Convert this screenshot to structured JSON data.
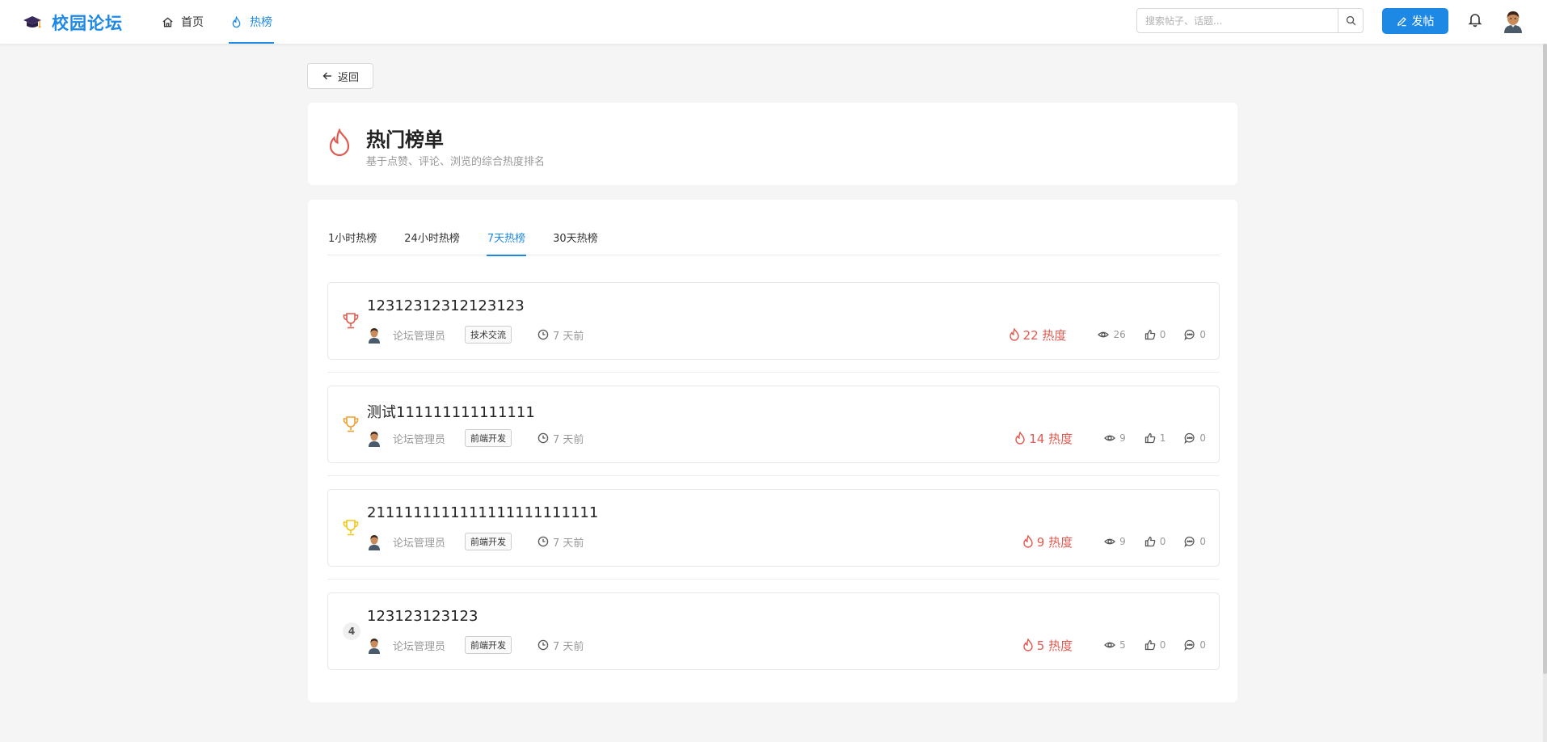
{
  "header": {
    "brand": "校园论坛",
    "nav": [
      {
        "label": "首页",
        "icon": "home-icon"
      },
      {
        "label": "热榜",
        "icon": "flame-icon"
      }
    ],
    "search_placeholder": "搜索帖子、话题...",
    "post_button": "发帖",
    "accent_color": "#1e88e5"
  },
  "back_label": "返回",
  "page": {
    "title": "热门榜单",
    "subtitle": "基于点赞、评论、浏览的综合热度排名"
  },
  "tabs": [
    "1小时热榜",
    "24小时热榜",
    "7天热榜",
    "30天热榜"
  ],
  "active_tab": "7天热榜",
  "posts": [
    {
      "rank": "1",
      "title": "12312312312123123",
      "author": "论坛管理员",
      "tag": "技术交流",
      "time": "7 天前",
      "heat": "22 热度",
      "views": "26",
      "likes": "0",
      "comments": "0",
      "trophy_color": "#e05a50"
    },
    {
      "rank": "2",
      "title": "测试111111111111111",
      "author": "论坛管理员",
      "tag": "前端开发",
      "time": "7 天前",
      "heat": "14 热度",
      "views": "9",
      "likes": "1",
      "comments": "0",
      "trophy_color": "#f0a030"
    },
    {
      "rank": "3",
      "title": "2111111111111111111111111",
      "author": "论坛管理员",
      "tag": "前端开发",
      "time": "7 天前",
      "heat": "9 热度",
      "views": "9",
      "likes": "0",
      "comments": "0",
      "trophy_color": "#f5c518"
    },
    {
      "rank": "4",
      "title": "123123123123",
      "author": "论坛管理员",
      "tag": "前端开发",
      "time": "7 天前",
      "heat": "5 热度",
      "views": "5",
      "likes": "0",
      "comments": "0",
      "trophy_color": ""
    }
  ]
}
